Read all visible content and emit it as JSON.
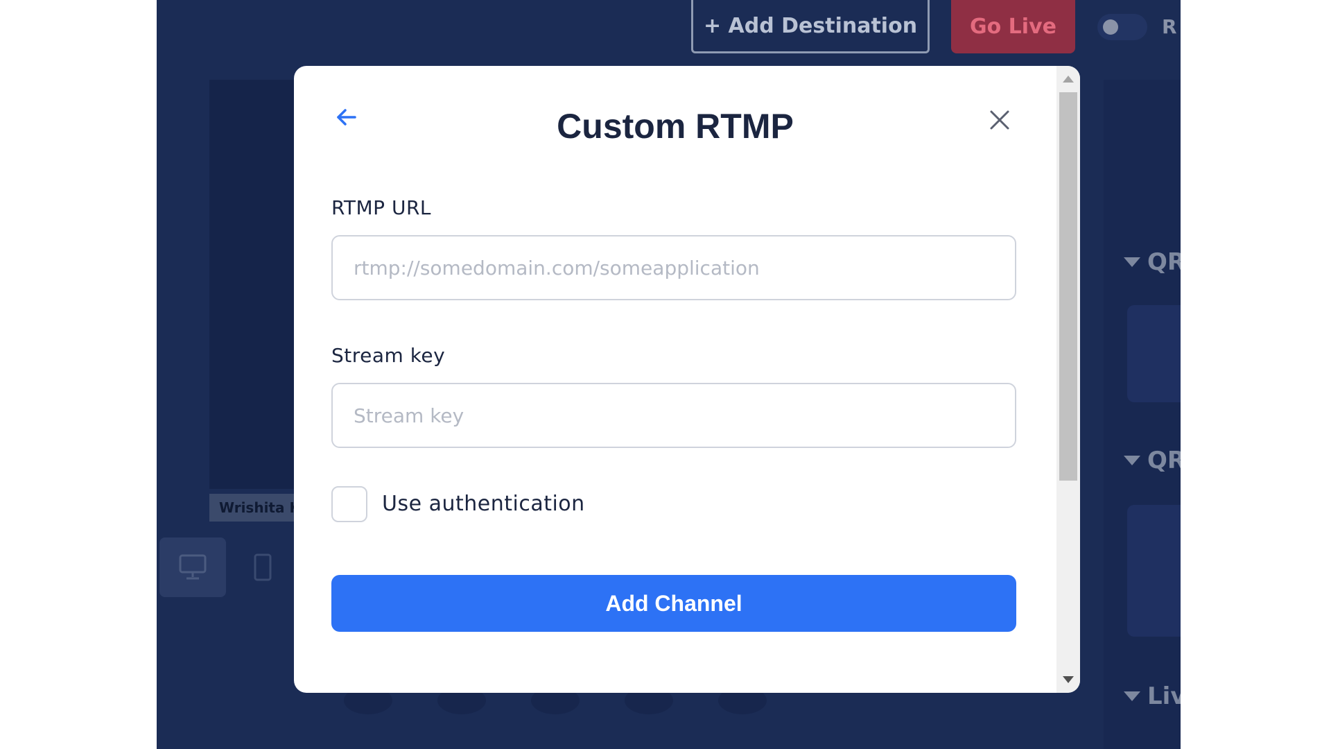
{
  "background_app": {
    "add_destination_label": "+ Add Destination",
    "go_live_label": "Go Live",
    "toggle_label": "R",
    "participant_name": "Wrishita K",
    "side_sections": [
      {
        "label": "QR"
      },
      {
        "label": "QR"
      },
      {
        "label": "Liv"
      }
    ]
  },
  "modal": {
    "title": "Custom RTMP",
    "rtmp_url_label": "RTMP URL",
    "rtmp_url_placeholder": "rtmp://somedomain.com/someapplication",
    "rtmp_url_value": "",
    "stream_key_label": "Stream key",
    "stream_key_placeholder": "Stream key",
    "stream_key_value": "",
    "use_auth_label": "Use authentication",
    "use_auth_checked": false,
    "submit_label": "Add Channel"
  },
  "colors": {
    "accent": "#2d72f5",
    "backdrop": "#1b2c55",
    "go_live": "#8f2f44",
    "text": "#1b2540"
  }
}
